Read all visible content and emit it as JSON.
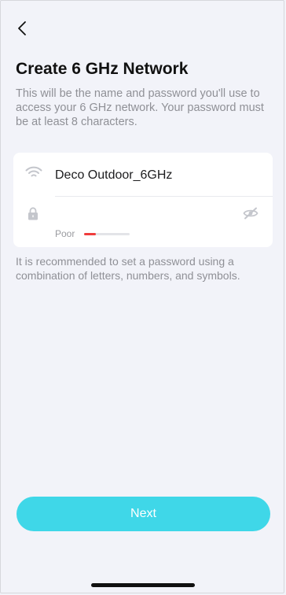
{
  "page": {
    "title": "Create 6 GHz Network",
    "description": "This will be the name and password you'll use to access your 6 GHz network. Your password must be at least 8 characters."
  },
  "form": {
    "ssid": {
      "icon": "wifi-icon",
      "value": "Deco Outdoor_6GHz"
    },
    "password": {
      "icon": "lock-icon",
      "value": "",
      "visibility_icon": "eye-hidden-icon"
    },
    "strength": {
      "label": "Poor",
      "level": 0.25,
      "color": "#f03c3c"
    }
  },
  "hint": "It is recommended to set a password using a combination of letters, numbers, and symbols.",
  "actions": {
    "next_label": "Next",
    "accent": "#3fd7e8"
  },
  "nav": {
    "back_icon": "chevron-left-icon"
  }
}
